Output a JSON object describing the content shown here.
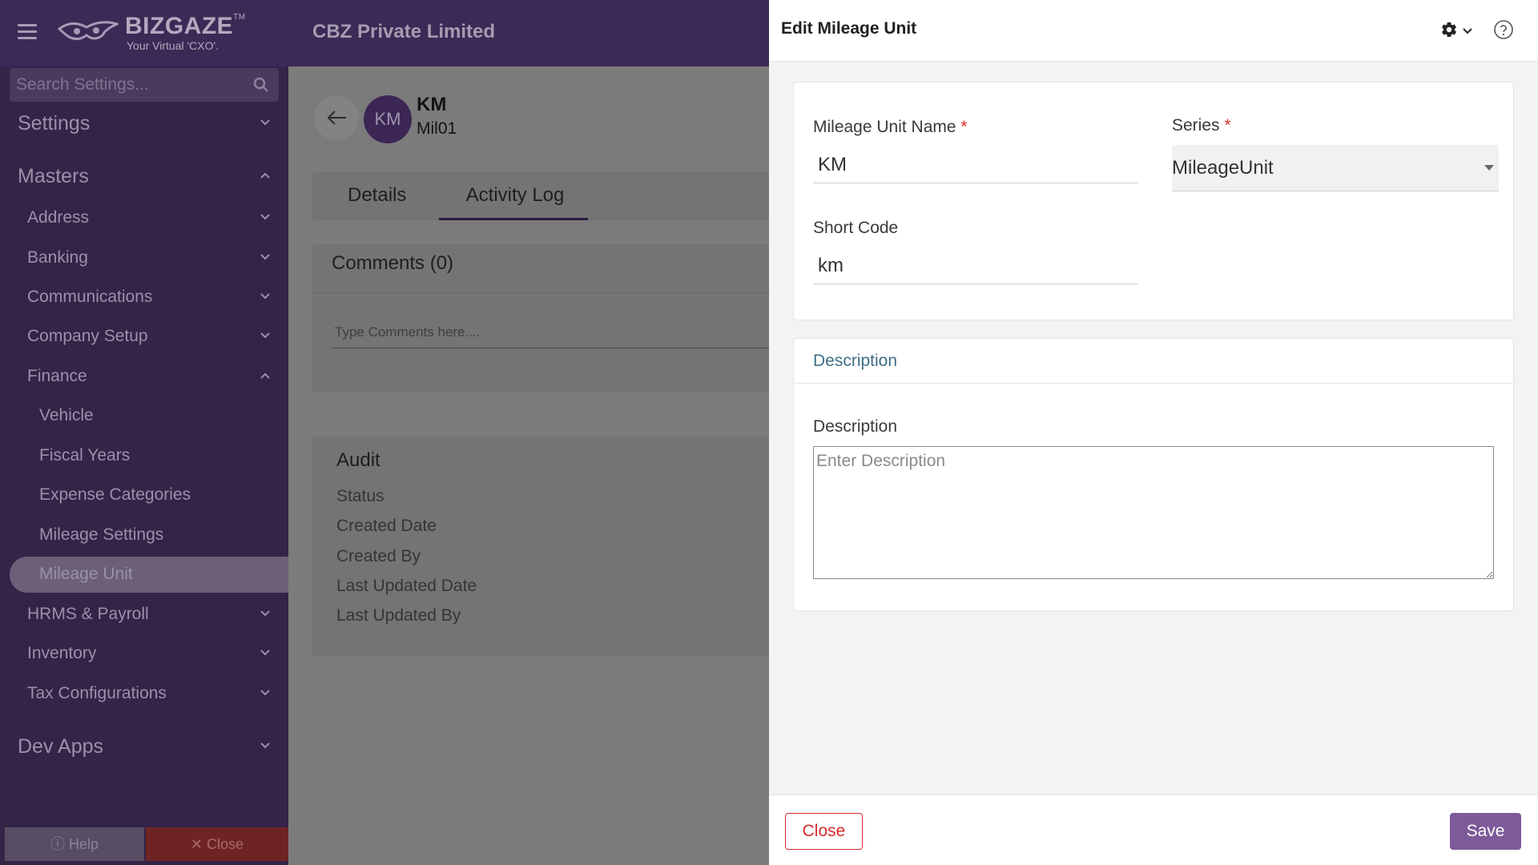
{
  "header": {
    "logo_text": "BIZGAZE",
    "logo_tagline": "Your Virtual 'CXO'.",
    "company": "CBZ Private Limited"
  },
  "sidebar": {
    "search_placeholder": "Search Settings...",
    "items": [
      {
        "label": "Settings",
        "state": "collapsed"
      },
      {
        "label": "Masters",
        "state": "expanded"
      },
      {
        "label": "Address",
        "state": "collapsed"
      },
      {
        "label": "Banking",
        "state": "collapsed"
      },
      {
        "label": "Communications",
        "state": "collapsed"
      },
      {
        "label": "Company Setup",
        "state": "collapsed"
      },
      {
        "label": "Finance",
        "state": "expanded"
      },
      {
        "label": "Vehicle"
      },
      {
        "label": "Fiscal Years"
      },
      {
        "label": "Expense Categories"
      },
      {
        "label": "Mileage Settings"
      },
      {
        "label": "Mileage Unit",
        "active": true
      },
      {
        "label": "HRMS & Payroll",
        "state": "collapsed"
      },
      {
        "label": "Inventory",
        "state": "collapsed"
      },
      {
        "label": "Tax Configurations",
        "state": "collapsed"
      },
      {
        "label": "Dev Apps",
        "state": "collapsed"
      }
    ],
    "help_label": "Help",
    "close_label": "Close"
  },
  "record": {
    "avatar_initials": "KM",
    "title": "KM",
    "subtitle": "Mil01"
  },
  "tabs": [
    {
      "label": "Details"
    },
    {
      "label": "Activity Log",
      "active": true
    }
  ],
  "comments": {
    "title": "Comments (0)",
    "placeholder": "Type Comments here...."
  },
  "audit": {
    "title": "Audit",
    "rows": [
      "Status",
      "Created Date",
      "Created By",
      "Last Updated Date",
      "Last Updated By"
    ]
  },
  "panel": {
    "title": "Edit Mileage Unit",
    "fields": {
      "name_label": "Mileage Unit Name",
      "name_value": "KM",
      "series_label": "Series",
      "series_value": "MileageUnit",
      "short_code_label": "Short Code",
      "short_code_value": "km",
      "required_mark": "*"
    },
    "description_section": {
      "title": "Description",
      "label": "Description",
      "placeholder": "Enter Description"
    },
    "close_label": "Close",
    "save_label": "Save"
  },
  "colors": {
    "brand_purple": "#3d2955",
    "save_button": "#7d5a99",
    "close_red": "#d62b2b",
    "required_red": "#e02b2b"
  }
}
